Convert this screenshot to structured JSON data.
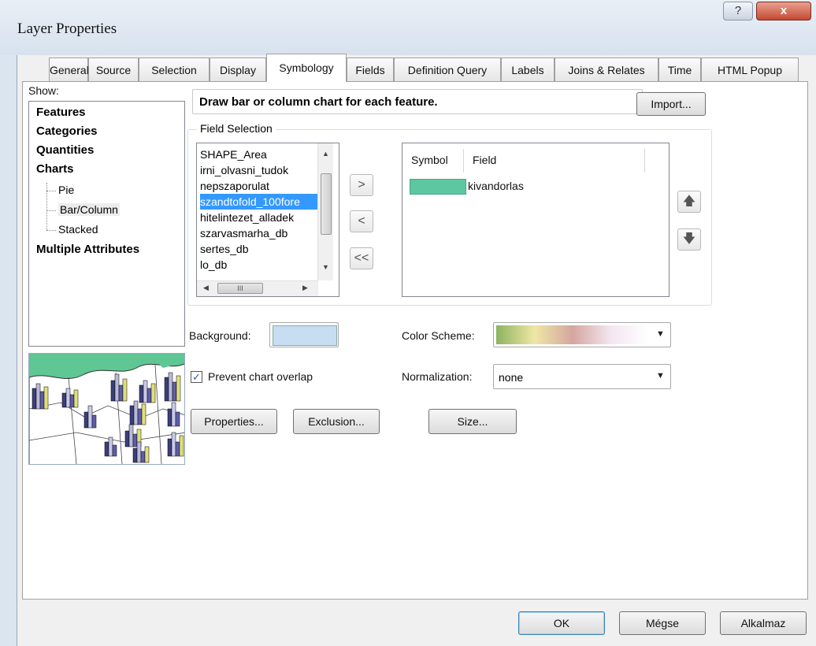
{
  "window": {
    "title": "Layer Properties",
    "help_glyph": "?",
    "close_glyph": "x"
  },
  "tabs": [
    {
      "label": "General"
    },
    {
      "label": "Source"
    },
    {
      "label": "Selection"
    },
    {
      "label": "Display"
    },
    {
      "label": "Symbology"
    },
    {
      "label": "Fields"
    },
    {
      "label": "Definition Query"
    },
    {
      "label": "Labels"
    },
    {
      "label": "Joins & Relates"
    },
    {
      "label": "Time"
    },
    {
      "label": "HTML Popup"
    }
  ],
  "active_tab": "Symbology",
  "show": {
    "label": "Show:",
    "items": [
      "Features",
      "Categories",
      "Quantities",
      "Charts",
      "Multiple Attributes"
    ],
    "chart_children": [
      "Pie",
      "Bar/Column",
      "Stacked"
    ],
    "selected_child": "Bar/Column"
  },
  "description": "Draw bar or column chart for each feature.",
  "import_label": "Import...",
  "field_selection": {
    "label": "Field Selection",
    "fields": [
      "SHAPE_Area",
      "irni_olvasni_tudok",
      "nepszaporulat",
      "szandtofold_100fore",
      "hitelintezet_alladek",
      "szarvasmarha_db",
      "sertes_db",
      "lo_db"
    ],
    "selected_field": "szandtofold_100fore",
    "hscroll_glyph": "III",
    "move_right_label": ">",
    "move_left_label": "<",
    "move_all_left_label": "<<",
    "symbol_col": "Symbol",
    "field_col": "Field",
    "rows": [
      {
        "field": "kivandorlas",
        "color": "#5cc7a0"
      }
    ],
    "move_up_glyph": "🡅",
    "move_down_glyph": "🡇"
  },
  "background": {
    "label": "Background:",
    "color": "#c7ddf2"
  },
  "color_scheme": {
    "label": "Color  Scheme:",
    "colors": [
      "#8db35f",
      "#efe6a5",
      "#d5a6a0",
      "#f3e6f0"
    ]
  },
  "prevent_overlap": {
    "label": "Prevent chart overlap",
    "checked": true
  },
  "normalization": {
    "label": "Normalization:",
    "value": "none"
  },
  "buttons": {
    "properties": "Properties...",
    "exclusion": "Exclusion...",
    "size": "Size...",
    "ok": "OK",
    "cancel": "Mégse",
    "apply": "Alkalmaz"
  }
}
